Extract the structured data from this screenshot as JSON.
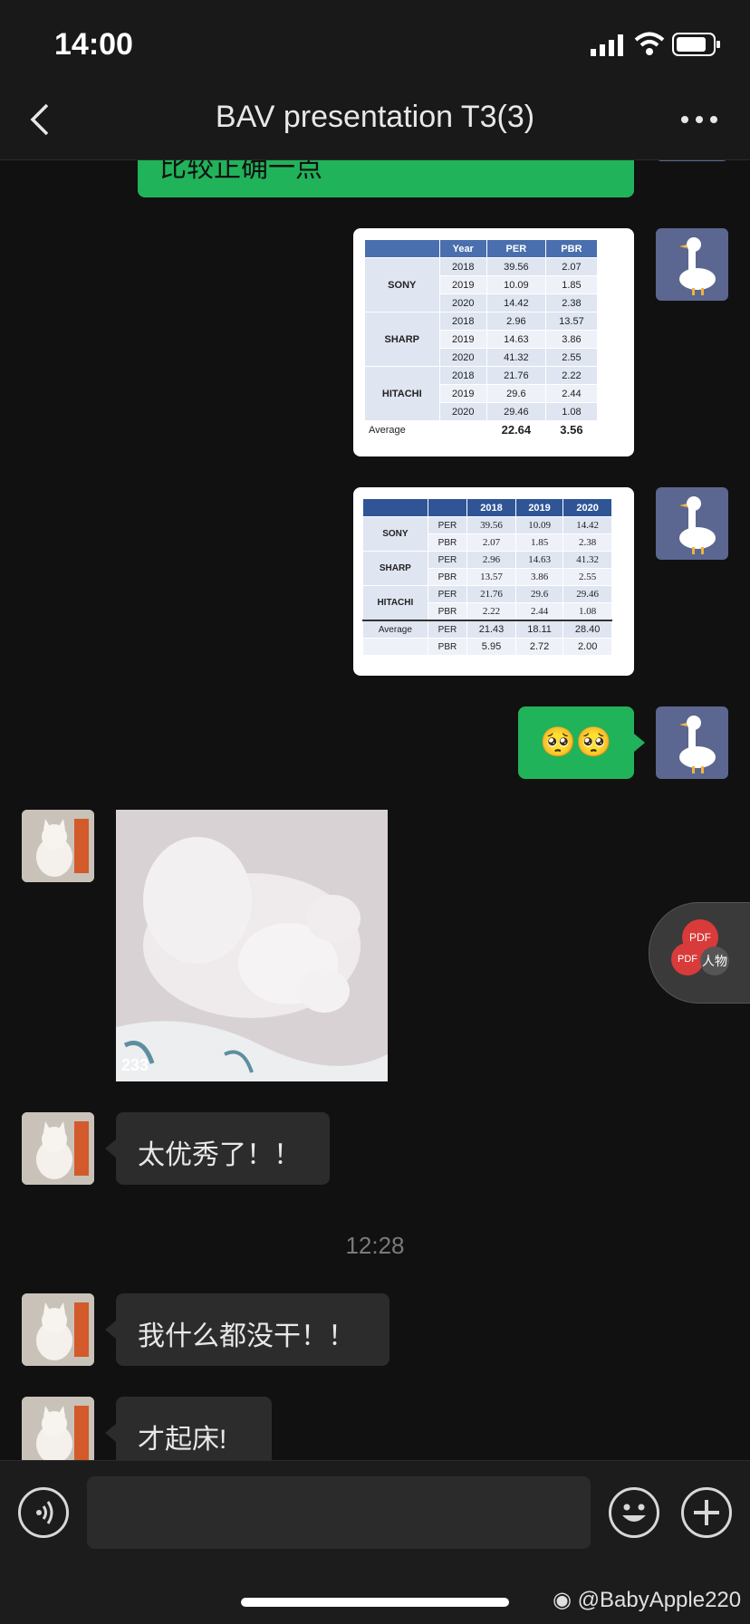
{
  "status": {
    "time": "14:00"
  },
  "nav": {
    "title": "BAV presentation T3(3)"
  },
  "messages": {
    "top_partial": "比较正确一点",
    "emoji": "🥺🥺",
    "cat_caption": "233",
    "msg1": "太优秀了！！",
    "timestamp": "12:28",
    "msg2": "我什么都没干！！",
    "msg3": "才起床!"
  },
  "table1": {
    "headers": [
      "Year",
      "PER",
      "PBR"
    ],
    "groups": [
      {
        "name": "SONY",
        "rows": [
          [
            "2018",
            "39.56",
            "2.07"
          ],
          [
            "2019",
            "10.09",
            "1.85"
          ],
          [
            "2020",
            "14.42",
            "2.38"
          ]
        ]
      },
      {
        "name": "SHARP",
        "rows": [
          [
            "2018",
            "2.96",
            "13.57"
          ],
          [
            "2019",
            "14.63",
            "3.86"
          ],
          [
            "2020",
            "41.32",
            "2.55"
          ]
        ]
      },
      {
        "name": "HITACHI",
        "rows": [
          [
            "2018",
            "21.76",
            "2.22"
          ],
          [
            "2019",
            "29.6",
            "2.44"
          ],
          [
            "2020",
            "29.46",
            "1.08"
          ]
        ]
      }
    ],
    "average_label": "Average",
    "average": [
      "22.64",
      "3.56"
    ]
  },
  "table2": {
    "headers": [
      "2018",
      "2019",
      "2020"
    ],
    "groups": [
      {
        "name": "SONY",
        "rows": [
          [
            "PER",
            "39.56",
            "10.09",
            "14.42"
          ],
          [
            "PBR",
            "2.07",
            "1.85",
            "2.38"
          ]
        ]
      },
      {
        "name": "SHARP",
        "rows": [
          [
            "PER",
            "2.96",
            "14.63",
            "41.32"
          ],
          [
            "PBR",
            "13.57",
            "3.86",
            "2.55"
          ]
        ]
      },
      {
        "name": "HITACHI",
        "rows": [
          [
            "PER",
            "21.76",
            "29.6",
            "29.46"
          ],
          [
            "PBR",
            "2.22",
            "2.44",
            "1.08"
          ]
        ]
      }
    ],
    "average_label": "Average",
    "average_rows": [
      [
        "PER",
        "21.43",
        "18.11",
        "28.40"
      ],
      [
        "PBR",
        "5.95",
        "2.72",
        "2.00"
      ]
    ]
  },
  "floating": {
    "pdf1": "PDF",
    "pdf2": "PDF",
    "label": "人物"
  },
  "watermark": "@BabyApple220",
  "colors": {
    "green_bubble": "#21b35a",
    "background": "#111111",
    "dark_bubble": "#2c2c2c"
  }
}
